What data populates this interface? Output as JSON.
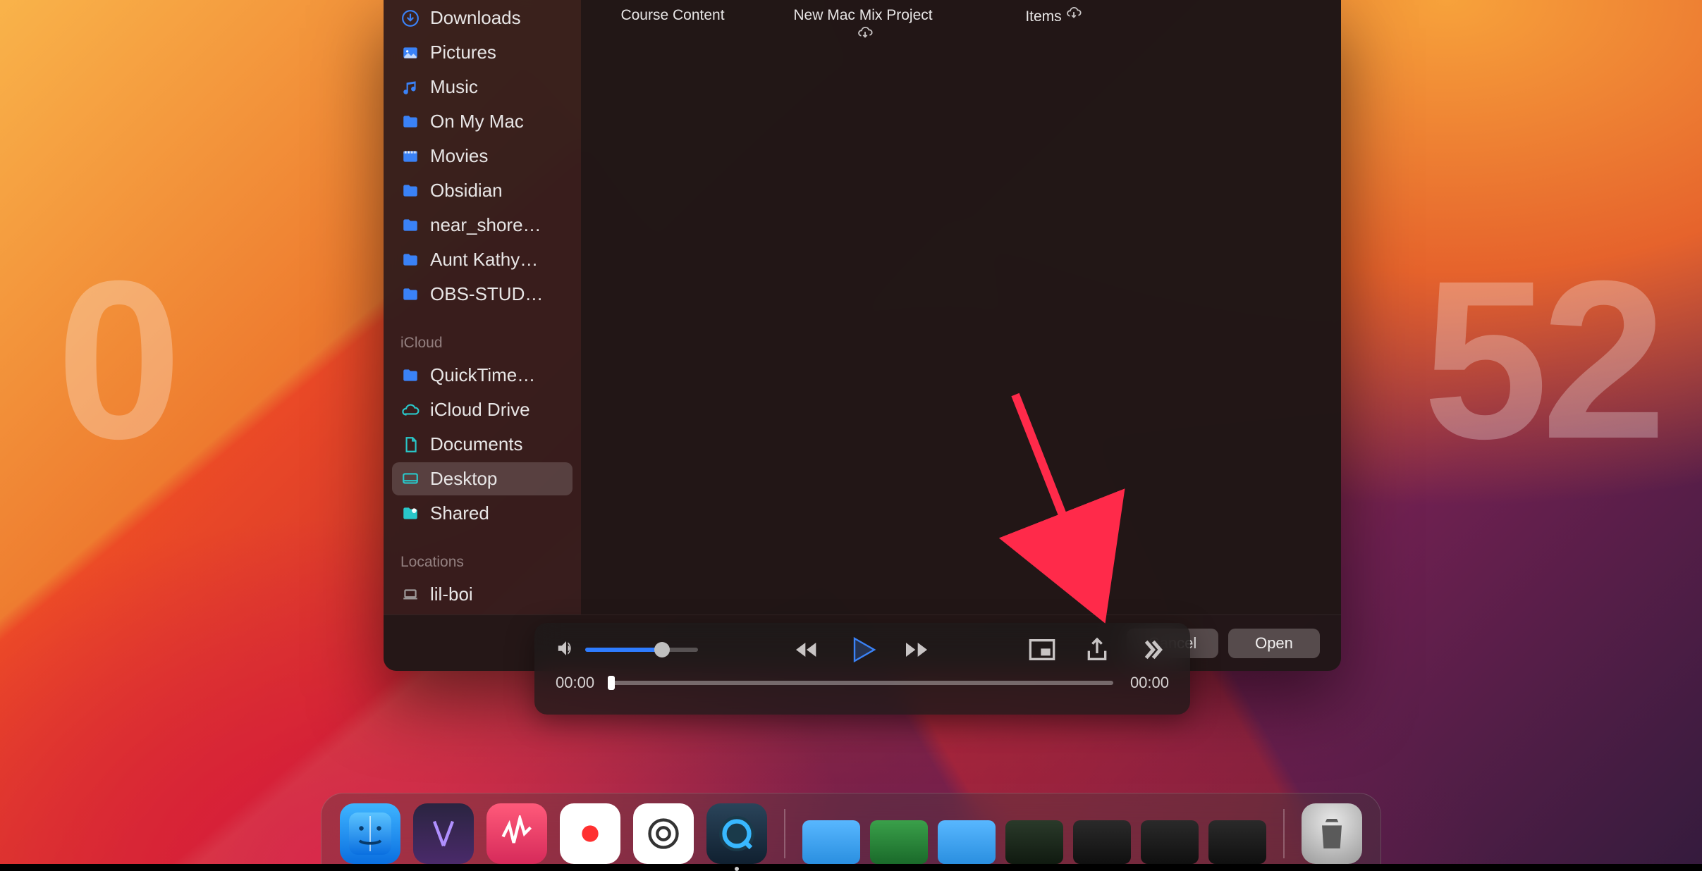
{
  "clock": {
    "left": "0",
    "right": "52"
  },
  "sidebar": {
    "favorites": [
      {
        "icon": "download",
        "label": "Downloads",
        "color": "#3a82f7"
      },
      {
        "icon": "image",
        "label": "Pictures",
        "color": "#3a82f7"
      },
      {
        "icon": "music",
        "label": "Music",
        "color": "#3a82f7"
      },
      {
        "icon": "folder",
        "label": "On My Mac",
        "color": "#3a82f7"
      },
      {
        "icon": "movie",
        "label": "Movies",
        "color": "#3a82f7"
      },
      {
        "icon": "folder",
        "label": "Obsidian",
        "color": "#3a82f7"
      },
      {
        "icon": "folder",
        "label": "near_shore…",
        "color": "#3a82f7"
      },
      {
        "icon": "folder",
        "label": "Aunt Kathy…",
        "color": "#3a82f7"
      },
      {
        "icon": "folder",
        "label": "OBS-STUD…",
        "color": "#3a82f7"
      }
    ],
    "sections": [
      {
        "label": "iCloud",
        "items": [
          {
            "icon": "folder",
            "label": "QuickTime…",
            "color": "#3a82f7"
          },
          {
            "icon": "cloud",
            "label": "iCloud Drive",
            "color": "#29c7c9"
          },
          {
            "icon": "document",
            "label": "Documents",
            "color": "#29c7c9"
          },
          {
            "icon": "desktop",
            "label": "Desktop",
            "color": "#29c7c9",
            "selected": true
          },
          {
            "icon": "shared",
            "label": "Shared",
            "color": "#29c7c9"
          }
        ]
      },
      {
        "label": "Locations",
        "items": [
          {
            "icon": "laptop",
            "label": "lil-boi",
            "color": "#9e9a9a"
          }
        ]
      }
    ]
  },
  "content": {
    "items": [
      {
        "label": "Course Content",
        "cloud": false
      },
      {
        "label": "New Mac Mix Project",
        "cloud": true
      },
      {
        "label": "Items",
        "cloud": true
      }
    ]
  },
  "dialog": {
    "cancel": "Cancel",
    "open": "Open"
  },
  "media": {
    "volume_percent": 68,
    "time_left": "00:00",
    "time_right": "00:00",
    "progress_percent": 0
  },
  "dock": {
    "apps": [
      {
        "name": "finder",
        "bg": "linear-gradient(#3fb4ff,#0a6fe0)",
        "running": false
      },
      {
        "name": "xcode",
        "bg": "linear-gradient(#2a2440,#4a2a6a)",
        "running": false
      },
      {
        "name": "activity",
        "bg": "linear-gradient(#ff5a7a,#d62a5a)",
        "running": false
      },
      {
        "name": "record",
        "bg": "#ffffff",
        "running": false
      },
      {
        "name": "chatgpt",
        "bg": "#ffffff",
        "running": false
      },
      {
        "name": "quicktime",
        "bg": "linear-gradient(#2a445a,#102030)",
        "running": true
      }
    ],
    "minis": [
      {
        "name": "folder-blue-1",
        "bg": "linear-gradient(#58b7ff,#2a8fe0)"
      },
      {
        "name": "folder-green",
        "bg": "linear-gradient(#3aa04a,#1a6a2a)"
      },
      {
        "name": "folder-blue-2",
        "bg": "linear-gradient(#58b7ff,#2a8fe0)"
      },
      {
        "name": "term-1",
        "bg": "linear-gradient(#2a3a2a,#101a10)"
      },
      {
        "name": "term-2",
        "bg": "linear-gradient(#2a2a2a,#101010)"
      },
      {
        "name": "term-3",
        "bg": "linear-gradient(#2a2a2a,#101010)"
      },
      {
        "name": "term-4",
        "bg": "linear-gradient(#2a2a2a,#101010)"
      }
    ],
    "trash": {
      "name": "trash"
    }
  }
}
